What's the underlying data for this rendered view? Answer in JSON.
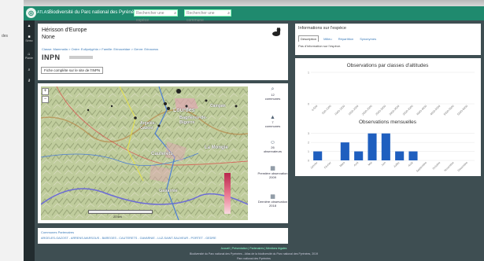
{
  "app": {
    "logo_text": "ATLAS",
    "title": "Biodiversité du Parc national des Pyrénées",
    "search_species_placeholder": "Rechercher une espèce",
    "search_commune_placeholder": "Rechercher une commune"
  },
  "background": {
    "left_text": "des"
  },
  "sidebar": {
    "items": [
      {
        "icon": "home-icon",
        "glyph": "▲",
        "label": ""
      },
      {
        "icon": "square-icon",
        "glyph": "■",
        "label": "Sérez"
      },
      {
        "icon": "house-icon",
        "glyph": "⌂",
        "label": "Plante"
      },
      {
        "icon": "search-icon",
        "glyph": "⌕",
        "label": ""
      },
      {
        "icon": "link-icon",
        "glyph": "∂",
        "label": ""
      }
    ]
  },
  "species": {
    "title": "Hérisson d'Europe",
    "subtitle": "None",
    "breadcrumb": "Classe: Mammalia > Ordre: Eulipotyphla > Famille: Erinaceidae > Genre: Erinaceus",
    "inpn_label": "INPN",
    "inpn_button": "Fiche complète sur le site de l'INPN"
  },
  "map": {
    "places": [
      "Lourdes",
      "Bagnères-de-Bigorre",
      "Argelès-Gazost",
      "Cauterets",
      "Gavarnie",
      "La Mongie",
      "Campan"
    ],
    "scale_label": "20 km",
    "stats": [
      {
        "icon": "search-icon",
        "value": "12",
        "label": "communes"
      },
      {
        "icon": "mountain-icon",
        "value": "7",
        "label": "communes"
      },
      {
        "icon": "person-icon",
        "value": "26",
        "label": "observateurs"
      },
      {
        "icon": "calendar-icon",
        "value": "Première observation",
        "label": "2009"
      },
      {
        "icon": "calendar-icon",
        "value": "Dernière observation",
        "label": "2018"
      }
    ]
  },
  "info": {
    "title": "Informations sur l'espèce",
    "tabs": [
      "Description",
      "Milieu",
      "Répartition",
      "Synonymes"
    ],
    "body": "Pas d'information sur l'espèce."
  },
  "charts": {
    "altitude_title": "Observations par classes d'altitudes",
    "monthly_title": "Observations mensuelles"
  },
  "chart_data": [
    {
      "type": "bar",
      "title": "Observations par classes d'altitudes",
      "categories": [
        "0-500",
        "500-1000",
        "1000-1500",
        "1500-2000",
        "2000-2500",
        "2500-3000",
        "3000-3500",
        "3500-4000",
        "4000-4500",
        "4500-5000",
        "5000-5500",
        "5500-6000"
      ],
      "values": [
        0,
        0,
        0,
        0,
        0,
        0,
        0,
        0,
        0,
        0,
        0,
        0
      ]
    },
    {
      "type": "bar",
      "title": "Observations mensuelles",
      "categories": [
        "Janvier",
        "Février",
        "Mars",
        "Avril",
        "Mai",
        "Juin",
        "Juillet",
        "Août",
        "Septembre",
        "Octobre",
        "Novembre",
        "Décembre"
      ],
      "values": [
        1,
        0,
        2,
        1,
        3,
        3,
        1,
        1,
        0,
        0,
        0,
        0
      ],
      "ylim": [
        0,
        3.5
      ],
      "color": "#1f5fbf"
    }
  ],
  "links": {
    "tabs": "Communes   Partenaires",
    "communes": "ARGELES-GAZOST - ARRENS-MARSOUS - BAREGES - CAUTERETS - GAVARNIE - LUZ-SAINT-SAUVEUR - PORTET - GEDRE"
  },
  "footer": {
    "line1": "Accueil | Présentation | Partenaires | Mentions légales",
    "line2": "Biodiversité du Parc national des Pyrénées - Atlas de la biodiversité du Parc national des Pyrénées, 2019",
    "line3": "Parc national des Pyrénées"
  }
}
